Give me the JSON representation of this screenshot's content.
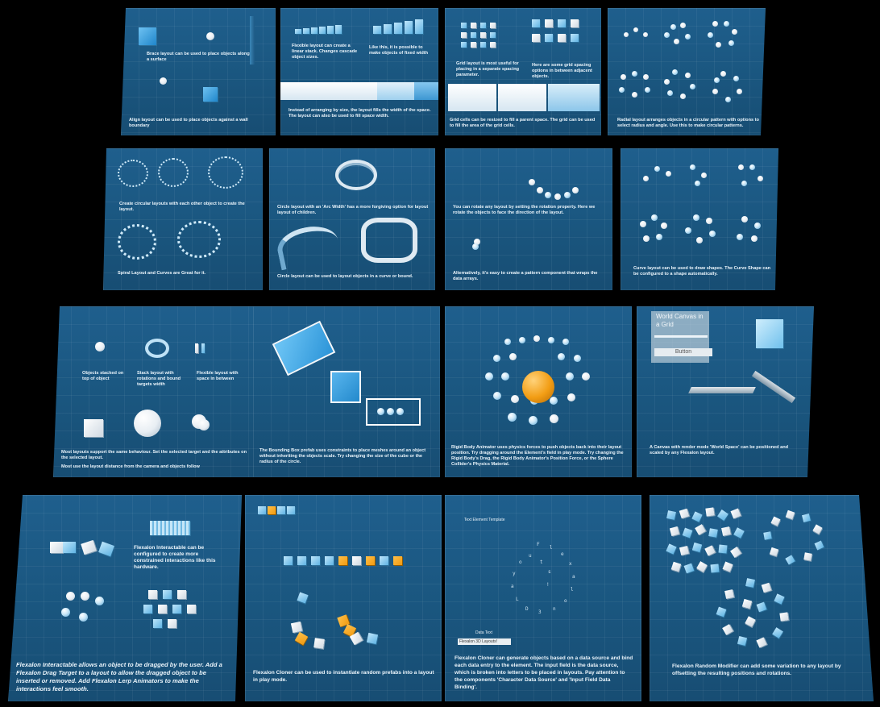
{
  "panels": [
    {
      "id": "p1",
      "captions": [
        "Brace layout can be used to place objects along a surface",
        "Align layout can be used to place objects against a wall boundary"
      ]
    },
    {
      "id": "p2",
      "captions": [
        "Flexible layout can create a linear stack. Changes cascade object sizes.",
        "Like this, it is possible to make objects of fixed width",
        "Instead of arranging by size, the layout fills the width of the space. The layout can also be used to fill space width."
      ]
    },
    {
      "id": "p3",
      "captions": [
        "Grid layout is most useful for placing in a separate spacing parameter.",
        "Here are some grid spacing options in between adjacent objects.",
        "Grid cells can be resized to fill a parent space. The grid can be used to fill the area of the grid cells."
      ]
    },
    {
      "id": "p4",
      "captions": [
        "Radial layout arranges objects in a circular pattern with options to select radius and angle. Use this to make circular patterns."
      ]
    },
    {
      "id": "p5",
      "captions": [
        "Create circular layouts with each other object to create the layout.",
        "Spiral Layout and Curves are Great for it."
      ]
    },
    {
      "id": "p6",
      "captions": [
        "Circle layout with an 'Arc Width' has a more forgiving option for layout layout of children.",
        "Circle layout can be used to layout objects in a curve or bound."
      ]
    },
    {
      "id": "p7",
      "captions": [
        "You can rotate any layout by setting the rotation property. Here we rotate the objects to face the direction of the layout.",
        "Alternatively, it's easy to create a pattern component that wraps the data arrays."
      ]
    },
    {
      "id": "p8",
      "captions": [
        "Curve layout can be used to draw shapes. The Curve Shape can be configured to a shape automatically."
      ]
    },
    {
      "id": "p9",
      "captions": [
        "Objects stacked on top of object",
        "Stack layout with rotations and bound targets width",
        "Flexible layout with space in between",
        "Most layouts support the same behaviour. Set the selected target and the attributes on the selected layout.",
        "Most use the layout distance from the camera and objects follow"
      ]
    },
    {
      "id": "p10",
      "captions": [
        "The Bounding Box prefab uses constraints to place meshes around an object without inheriting the objects scale. Try changing the size of the cube or the radius of the circle."
      ]
    },
    {
      "id": "p11",
      "captions": [
        "Rigid Body Animator uses physics forces to push objects back into their layout position. Try dragging around the Element's field in play mode. Try changing the Rigid Body's Drag, the Rigid Body Animator's Position Force, or the Sphere Collider's Physics Material."
      ]
    },
    {
      "id": "p12",
      "world_title": "World Canvas in a Grid",
      "button_label": "Button",
      "captions": [
        "A Canvas with render mode 'World Space' can be positioned and scaled by any Flexalon layout."
      ]
    },
    {
      "id": "p13",
      "captions": [
        "Flexalon Interactable can be configured to create more constrained interactions like this hardware.",
        "Flexalon Interactable allows an object to be dragged by the user. Add a Flexalon Drag Target to a layout to allow the dragged object to be inserted or removed. Add Flexalon Lerp Animators to make the interactions feel smooth."
      ]
    },
    {
      "id": "p14",
      "captions": [
        "Flexalon Cloner can be used to instantiate random prefabs into a layout in play mode."
      ]
    },
    {
      "id": "p15",
      "template_title": "Text Element Template",
      "field_label": "Data Text",
      "field_value": "Flexalon 3D Layouts!",
      "spiral_text": "Flexalon 3D Layouts!",
      "captions": [
        "Flexalon Cloner can generate objects based on a data source and bind each data entry to the element. The input field is the data source, which is broken into letters to be placed in layouts. Pay attention to the components 'Character Data Source' and 'Input Field Data Binding'."
      ]
    },
    {
      "id": "p16",
      "captions": [
        "Flexalon Random Modifier can add some variation to any layout by offsetting the resulting positions and rotations."
      ]
    }
  ]
}
